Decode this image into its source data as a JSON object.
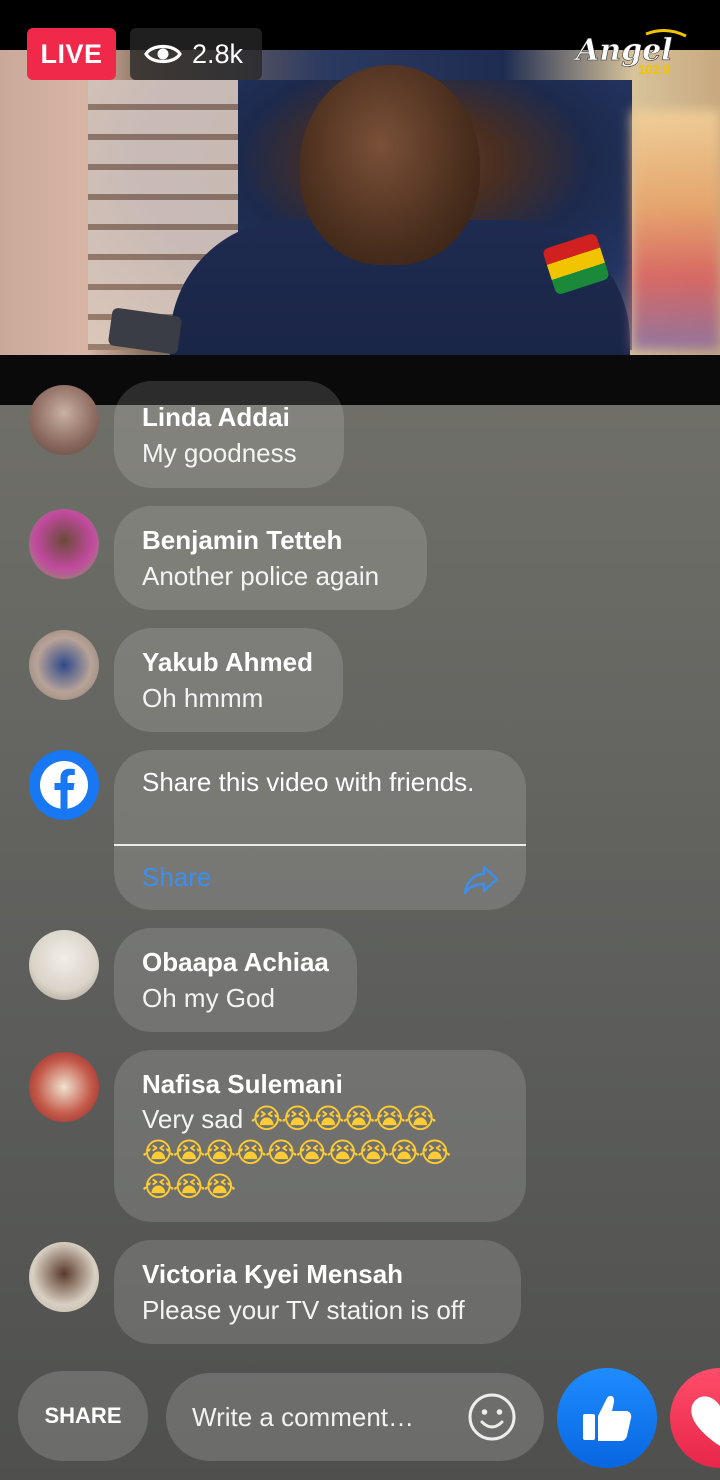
{
  "stream": {
    "live_label": "LIVE",
    "viewer_count": "2.8k",
    "station_logo_text": "Angel",
    "station_frequency": "102.9"
  },
  "comments": [
    {
      "name": "Linda Addai",
      "text": "My goodness"
    },
    {
      "name": "Benjamin Tetteh",
      "text": "Another police again"
    },
    {
      "name": "Yakub Ahmed",
      "text": "Oh hmmm"
    },
    {
      "name": "Obaapa Achiaa",
      "text": "Oh my God"
    },
    {
      "name": "Nafisa Sulemani",
      "text": "Very sad",
      "emoji_line1": "😭😭😭😭😭😭",
      "emoji_line2": "😭😭😭😭😭😭😭😭😭😭",
      "emoji_line3": "😭😭😭"
    },
    {
      "name": "Victoria Kyei Mensah",
      "text": "Please your TV station is off"
    }
  ],
  "share_prompt": {
    "message": "Share this video with friends.",
    "action_label": "Share"
  },
  "bottom_bar": {
    "share_label": "SHARE",
    "comment_placeholder": "Write a comment…"
  },
  "colors": {
    "live_red": "#f02849",
    "link_blue": "#3b8ff0",
    "like_blue": "#1877f2",
    "love_red": "#f33e58"
  },
  "icons": [
    "eye-icon",
    "facebook-icon",
    "share-arrow-icon",
    "smiley-icon",
    "thumbs-up-icon",
    "heart-icon"
  ]
}
